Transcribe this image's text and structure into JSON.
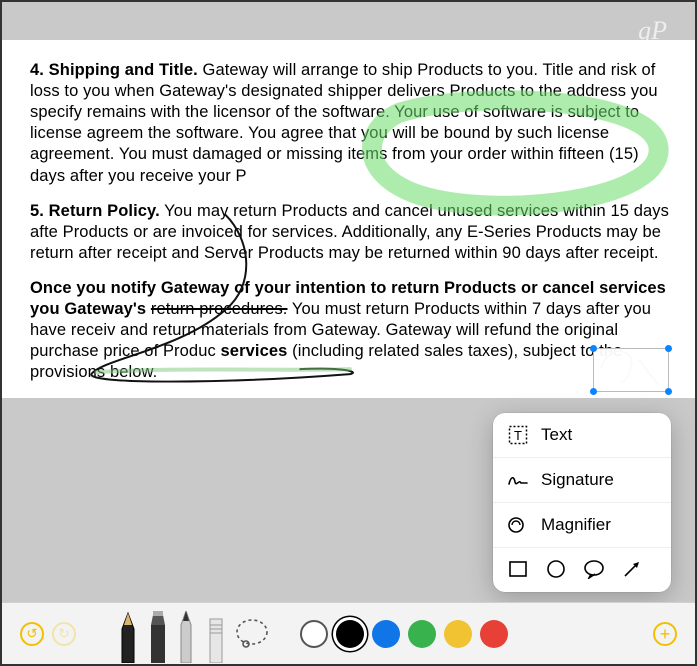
{
  "watermark": "gP",
  "document": {
    "section4": {
      "number": "4.",
      "title": "Shipping and Title.",
      "body": "Gateway will arrange to ship Products to you. Title and risk of loss to you when Gateway's designated shipper delivers Products to the address you specify remains with the licensor of the software. Your use of software is subject to license agreem the software. You agree that you will be bound by such license agreement. You must damaged or missing items from your order within fifteen (15) days after you receive your P"
    },
    "section5": {
      "number": "5.",
      "title": "Return Policy.",
      "body": "You may return Products and cancel unused services within 15 days afte Products or are invoiced for services. Additionally, any E-Series Products may be return after receipt and Server Products may be returned within 90 days after receipt."
    },
    "para3": {
      "pre": "Once you notify Gateway of your intention to return Products or cancel services you Gateway's ",
      "strike": "return procedures.",
      "post1": " You must return Products within 7 days after you have receiv and return materials from Gateway. Gateway will refund the original purchase price of Produc ",
      "bold2": "services",
      "post2": " (including related sales taxes), subject to the provisions below."
    }
  },
  "popup": {
    "text": "Text",
    "signature": "Signature",
    "magnifier": "Magnifier"
  },
  "toolbar": {
    "undo": "↺",
    "redo": "↻",
    "add": "+"
  },
  "colors": {
    "white": "#ffffff",
    "black": "#000000",
    "blue": "#1075e6",
    "green": "#38b24c",
    "yellow": "#f1c332",
    "red": "#e74037"
  }
}
